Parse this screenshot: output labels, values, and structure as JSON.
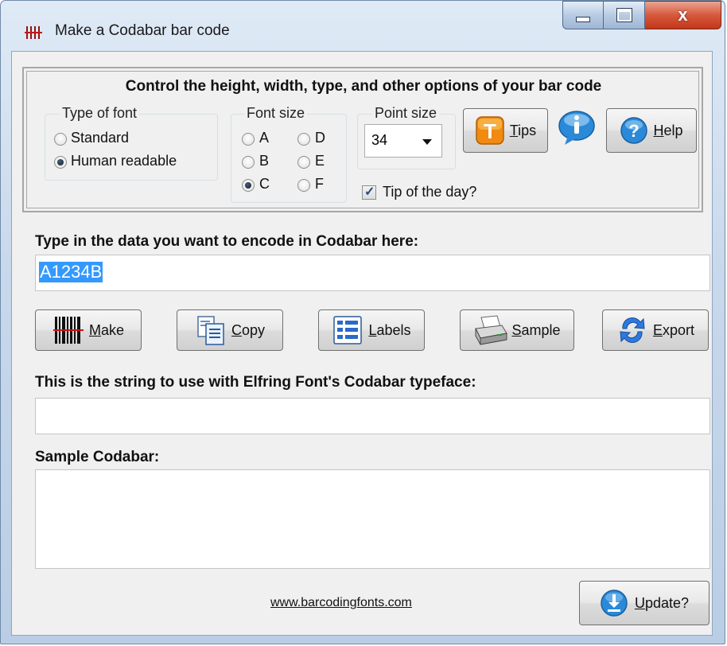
{
  "window": {
    "title": "Make a Codabar bar code"
  },
  "options": {
    "headline": "Control the height, width, type, and other options of your bar code",
    "type_of_font": {
      "legend": "Type of font",
      "options": [
        "Standard",
        "Human readable"
      ],
      "selected": "Human readable"
    },
    "font_size": {
      "legend": "Font size",
      "options": [
        "A",
        "B",
        "C",
        "D",
        "E",
        "F"
      ],
      "selected": "C"
    },
    "point_size": {
      "legend": "Point size",
      "value": "34"
    },
    "tip_of_day": {
      "label": "Tip of the day?",
      "checked": true
    },
    "buttons": {
      "tips_mnemonic": "T",
      "tips_rest": "ips",
      "help_mnemonic": "H",
      "help_rest": "elp"
    }
  },
  "input": {
    "label": "Type in the data you want to encode in Codabar here:",
    "value": "A1234B"
  },
  "actions": [
    {
      "mnemonic": "M",
      "rest": "ake",
      "icon": "barcode-icon"
    },
    {
      "mnemonic": "C",
      "rest": "opy",
      "icon": "copy-icon"
    },
    {
      "mnemonic": "L",
      "rest": "abels",
      "icon": "labels-icon"
    },
    {
      "mnemonic": "S",
      "rest": "ample",
      "icon": "printer-icon"
    },
    {
      "mnemonic": "E",
      "rest": "xport",
      "icon": "export-icon"
    }
  ],
  "output": {
    "label": "This is the string to use with Elfring Font's Codabar typeface:",
    "value": ""
  },
  "sample": {
    "label": "Sample Codabar:",
    "value": ""
  },
  "footer": {
    "link": "www.barcodingfonts.com",
    "update_mnemonic": "U",
    "update_rest": "pdate?"
  },
  "colors": {
    "selection": "#3399ff",
    "close_button": "#c3371b",
    "info_blue": "#2a8ad8",
    "tips_orange": "#f08a10"
  }
}
